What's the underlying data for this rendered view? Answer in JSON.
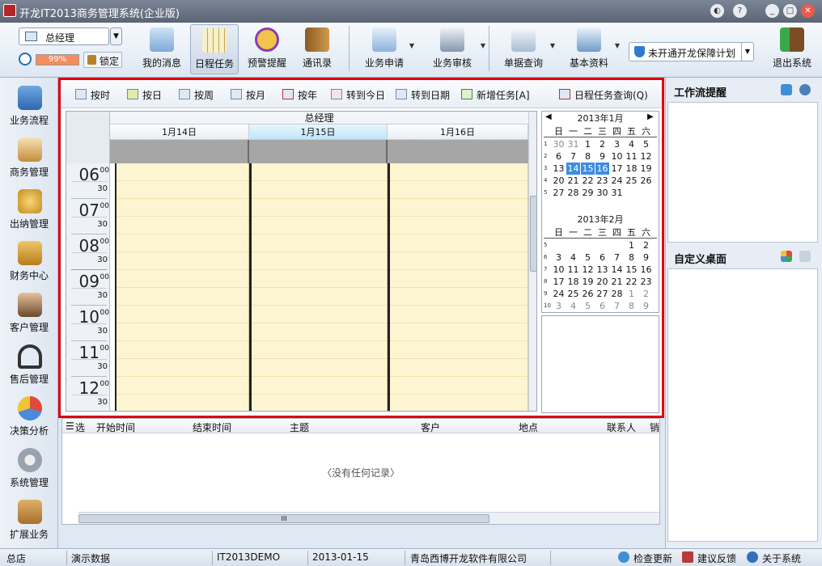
{
  "window": {
    "title": "开龙IT2013商务管理系统(企业版)",
    "buttons": [
      "◐",
      "?",
      "_",
      "□",
      "✕"
    ]
  },
  "toolbar": {
    "user": "总经理",
    "progress": "99%",
    "lock": "锁定",
    "items": [
      {
        "label": "我的消息",
        "icon": "message-icon"
      },
      {
        "label": "日程任务",
        "icon": "calendar-icon"
      },
      {
        "label": "预警提醒",
        "icon": "alarm-clock-icon"
      },
      {
        "label": "通讯录",
        "icon": "address-book-icon"
      },
      {
        "label": "业务申请",
        "icon": "org-chart-icon"
      },
      {
        "label": "业务审核",
        "icon": "approval-icon"
      },
      {
        "label": "单据查询",
        "icon": "document-search-icon"
      },
      {
        "label": "基本资料",
        "icon": "basic-data-icon"
      }
    ],
    "guarantee": "未开通开龙保障计划",
    "exit": "退出系统"
  },
  "leftnav": [
    "业务流程",
    "商务管理",
    "出纳管理",
    "财务中心",
    "客户管理",
    "售后管理",
    "决策分析",
    "系统管理",
    "扩展业务"
  ],
  "schedule_tools": [
    "按时",
    "按日",
    "按周",
    "按月",
    "按年",
    "转到今日",
    "转到日期",
    "新增任务[A]",
    "日程任务查询(Q)"
  ],
  "dayview": {
    "owner": "总经理",
    "days": [
      "1月14日",
      "1月15日",
      "1月16日"
    ],
    "hours": [
      "06",
      "07",
      "08",
      "09",
      "10",
      "11",
      "12"
    ],
    "min00": "00",
    "min30": "30"
  },
  "minical": {
    "jan": {
      "title": "2013年1月",
      "prev": "◀",
      "next": "▶",
      "weekdays": [
        "日",
        "一",
        "二",
        "三",
        "四",
        "五",
        "六"
      ],
      "weeks": [
        [
          "1",
          "30",
          "31",
          "1",
          "2",
          "3",
          "4",
          "5"
        ],
        [
          "2",
          "6",
          "7",
          "8",
          "9",
          "10",
          "11",
          "12"
        ],
        [
          "3",
          "13",
          "14",
          "15",
          "16",
          "17",
          "18",
          "19"
        ],
        [
          "4",
          "20",
          "21",
          "22",
          "23",
          "24",
          "25",
          "26"
        ],
        [
          "5",
          "27",
          "28",
          "29",
          "30",
          "31",
          "",
          ""
        ]
      ]
    },
    "feb": {
      "title": "2013年2月",
      "weekdays": [
        "日",
        "一",
        "二",
        "三",
        "四",
        "五",
        "六"
      ],
      "weeks": [
        [
          "5",
          "",
          "",
          "",
          "",
          "",
          "1",
          "2"
        ],
        [
          "6",
          "3",
          "4",
          "5",
          "6",
          "7",
          "8",
          "9"
        ],
        [
          "7",
          "10",
          "11",
          "12",
          "13",
          "14",
          "15",
          "16"
        ],
        [
          "8",
          "17",
          "18",
          "19",
          "20",
          "21",
          "22",
          "23"
        ],
        [
          "9",
          "24",
          "25",
          "26",
          "27",
          "28",
          "1",
          "2"
        ],
        [
          "10",
          "3",
          "4",
          "5",
          "6",
          "7",
          "8",
          "9"
        ]
      ]
    }
  },
  "grid": {
    "columns": [
      "选",
      "开始时间",
      "结束时间",
      "主题",
      "客户",
      "地点",
      "联系人",
      "销"
    ],
    "empty": "〈没有任何记录〉",
    "hscroll_mark": "III"
  },
  "rightpanel": {
    "workflow": "工作流提醒",
    "desktop": "自定义桌面"
  },
  "statusbar": {
    "branch": "总店",
    "data": "演示数据",
    "db": "IT2013DEMO",
    "date": "2013-01-15",
    "company": "青岛西博开龙软件有限公司",
    "update": "检查更新",
    "feedback": "建议反馈",
    "about": "关于系统"
  }
}
